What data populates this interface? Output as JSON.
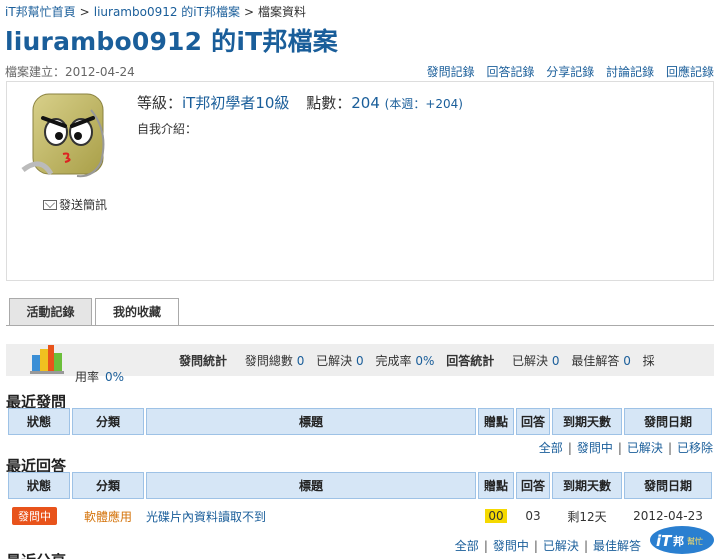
{
  "breadcrumb": {
    "home": "iT邦幫忙首頁",
    "profile": "liurambo0912 的iT邦檔案",
    "current": "檔案資料",
    "separator": ">"
  },
  "page_title": "liurambo0912 的iT邦檔案",
  "created": "檔案建立：2012-04-24",
  "top_links": [
    "發問記錄",
    "回答記錄",
    "分享記錄",
    "討論記錄",
    "回應記錄"
  ],
  "profile": {
    "send_message": "發送簡訊",
    "level_label": "等級：",
    "level_value": "iT邦初學者10級",
    "points_label": "點數：",
    "points_value": "204",
    "week_points": "(本週：+204)",
    "intro_label": "自我介紹："
  },
  "tabs": [
    "活動記錄",
    "我的收藏"
  ],
  "stats": {
    "ask_title": "發問統計",
    "ask_total_label": "發問總數",
    "ask_total": "0",
    "solved_label": "已解決",
    "solved": "0",
    "completion_label": "完成率",
    "completion": "0%",
    "answer_title": "回答統計",
    "ans_solved_label": "已解決",
    "ans_solved": "0",
    "best_label": "最佳解答",
    "best": "0",
    "adopt_label_a": "採",
    "adopt_label_b": "用率",
    "adopt_rate": "0%"
  },
  "recent_questions": {
    "title": "最近發問",
    "columns": [
      "狀態",
      "分類",
      "標題",
      "贈點",
      "回答",
      "到期天數",
      "發問日期"
    ],
    "filters": [
      "全部",
      "發問中",
      "已解決",
      "已移除"
    ]
  },
  "recent_answers": {
    "title": "最近回答",
    "columns": [
      "狀態",
      "分類",
      "標題",
      "贈點",
      "回答",
      "到期天數",
      "發問日期"
    ],
    "rows": [
      {
        "status": "發問中",
        "category": "軟體應用",
        "title": "光碟片內資料讀取不到",
        "points": "00",
        "answers": "03",
        "expires": "剩12天",
        "date": "2012-04-23"
      }
    ],
    "filters": [
      "全部",
      "發問中",
      "已解決",
      "最佳解答"
    ]
  },
  "next_section_title": "最近分享",
  "logo_text": "iT邦幫忙",
  "colors": {
    "link": "#1a5e9a",
    "header_bg": "#d6e6f6",
    "badge": "#e8531b",
    "category": "#d4730a",
    "highlight": "#f5d900"
  }
}
